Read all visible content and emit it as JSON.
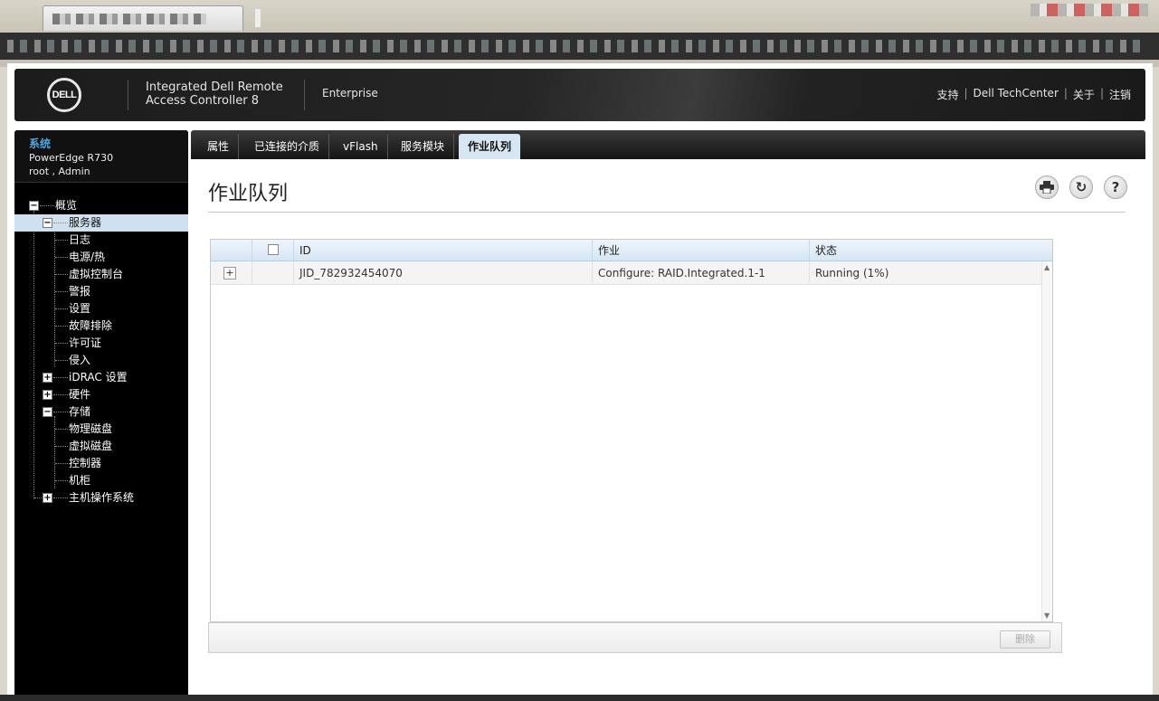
{
  "banner": {
    "logo": "DELL",
    "title_line1": "Integrated Dell Remote",
    "title_line2": "Access Controller 8",
    "edition": "Enterprise",
    "links": [
      "支持",
      "Dell TechCenter",
      "关于",
      "注销"
    ],
    "link_separator": "|"
  },
  "system": {
    "title": "系统",
    "model": "PowerEdge R730",
    "user": "root , Admin"
  },
  "tree": {
    "overview": "概览",
    "server": "服务器",
    "server_children": [
      "日志",
      "电源/热",
      "虚拟控制台",
      "警报",
      "设置",
      "故障排除",
      "许可证",
      "侵入"
    ],
    "idrac": "iDRAC 设置",
    "hardware": "硬件",
    "storage": "存储",
    "storage_children": [
      "物理磁盘",
      "虚拟磁盘",
      "控制器",
      "机柜"
    ],
    "host_os": "主机操作系统"
  },
  "tabs": [
    "属性",
    "已连接的介质",
    "vFlash",
    "服务模块",
    "作业队列"
  ],
  "active_tab": "作业队列",
  "page": {
    "title": "作业队列",
    "print_icon": "printer-icon",
    "refresh_icon": "refresh-icon",
    "help_icon": "help-icon"
  },
  "table": {
    "columns": [
      "ID",
      "作业",
      "状态"
    ],
    "rows": [
      {
        "expand": "+",
        "id": "JID_782932454070",
        "job": "Configure: RAID.Integrated.1-1",
        "status": "Running (1%)"
      }
    ]
  },
  "footer": {
    "delete_label": "删除"
  }
}
